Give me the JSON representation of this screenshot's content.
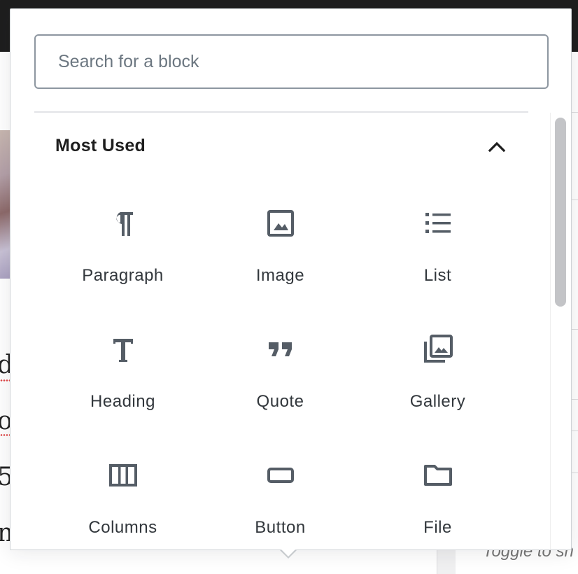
{
  "background": {
    "sidebar_footer_text": "Toggle to sh"
  },
  "inserter": {
    "search": {
      "placeholder": "Search for a block",
      "value": ""
    },
    "panel": {
      "title": "Most Used",
      "toggle_state": "expanded"
    },
    "blocks": [
      {
        "label": "Paragraph",
        "icon": "paragraph-icon"
      },
      {
        "label": "Image",
        "icon": "image-icon"
      },
      {
        "label": "List",
        "icon": "list-icon"
      },
      {
        "label": "Heading",
        "icon": "heading-icon"
      },
      {
        "label": "Quote",
        "icon": "quote-icon"
      },
      {
        "label": "Gallery",
        "icon": "gallery-icon"
      },
      {
        "label": "Columns",
        "icon": "columns-icon"
      },
      {
        "label": "Button",
        "icon": "button-icon"
      },
      {
        "label": "File",
        "icon": "file-icon"
      }
    ]
  },
  "colors": {
    "icon": "#555d66",
    "label": "#32373c",
    "border": "#8d96a0"
  }
}
